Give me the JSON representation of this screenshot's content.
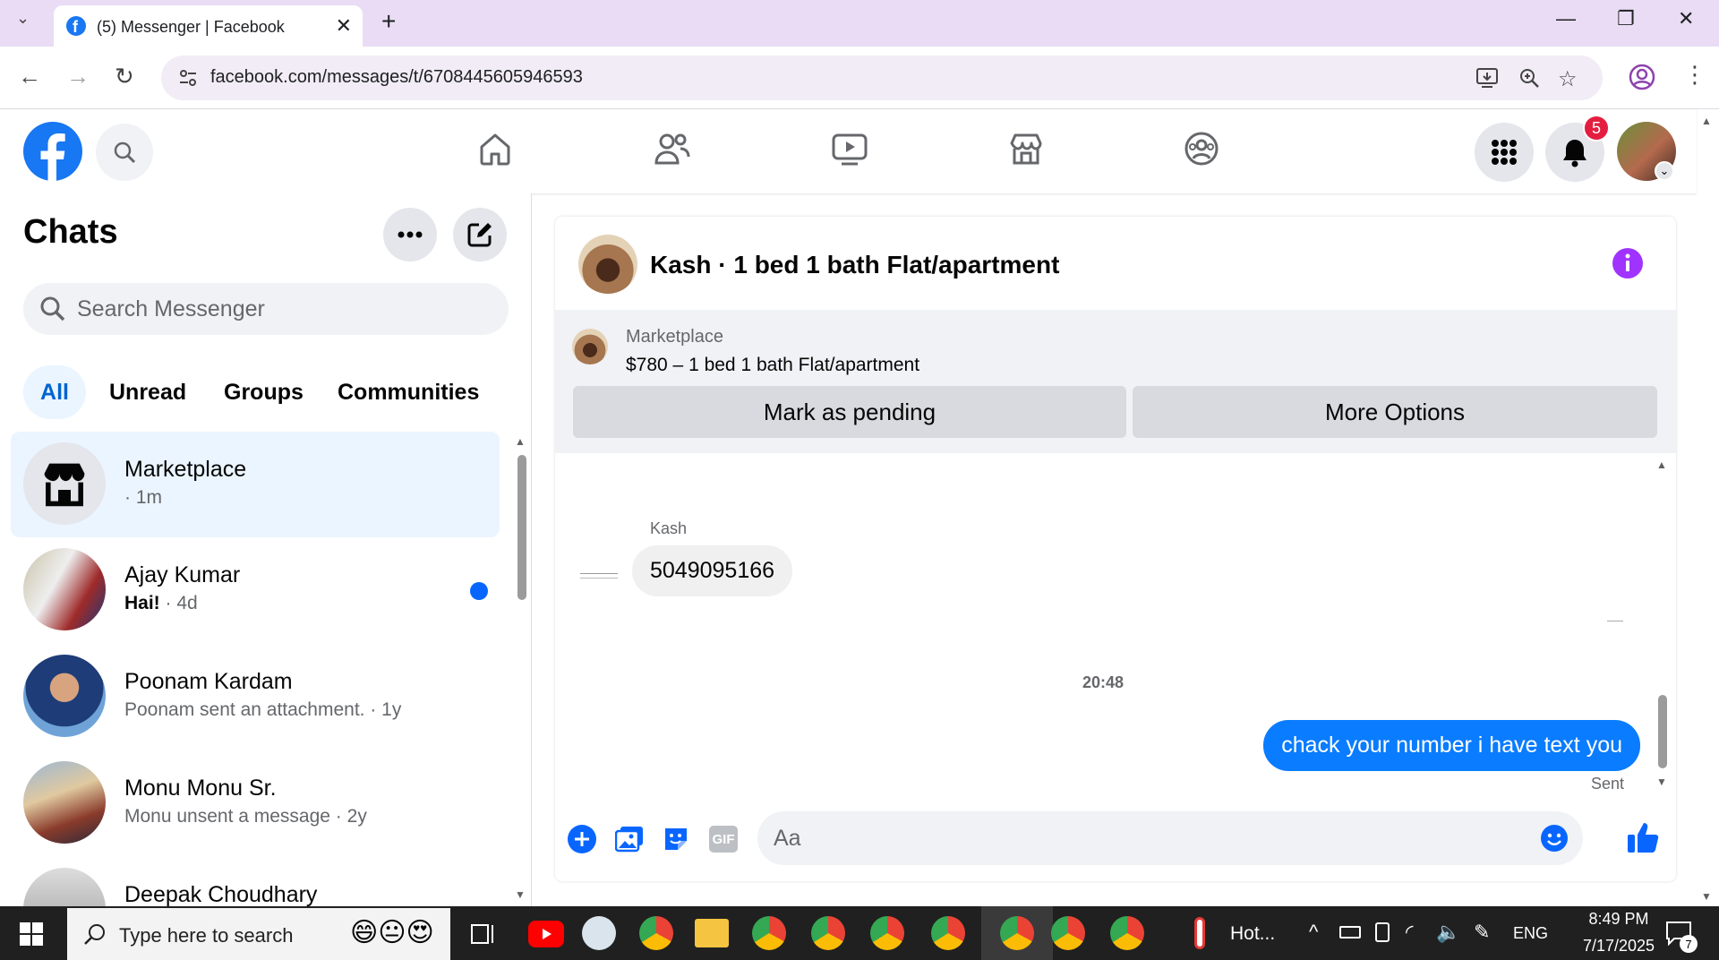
{
  "browser": {
    "tab_title": "(5) Messenger | Facebook",
    "url": "facebook.com/messages/t/6708445605946593",
    "new_tab_label": "+"
  },
  "fb_nav": {
    "notifications_count": "5",
    "brand_color": "#1877f2",
    "badge_color": "#e41e3f"
  },
  "sidebar": {
    "title": "Chats",
    "search_placeholder": "Search Messenger",
    "filters": [
      "All",
      "Unread",
      "Groups",
      "Communities"
    ],
    "chats": [
      {
        "name": "Marketplace",
        "sub": "· 1m",
        "active": true
      },
      {
        "name": "Ajay Kumar",
        "sub_bold": "Hai!",
        "sub": " · 4d",
        "unread": true
      },
      {
        "name": "Poonam Kardam",
        "sub": "Poonam sent an attachment. · 1y"
      },
      {
        "name": "Monu Monu Sr.",
        "sub": "Monu unsent a message · 2y"
      },
      {
        "name": "Deepak Choudhary",
        "sub": ""
      }
    ]
  },
  "conversation": {
    "title": "Kash · 1 bed 1 bath Flat/apartment",
    "marketplace_label": "Marketplace",
    "listing": "$780 – 1 bed 1 bath Flat/apartment",
    "mark_pending": "Mark as pending",
    "more_options": "More Options",
    "messages": [
      {
        "sender": "Kash",
        "text": "5049095166",
        "direction": "in"
      },
      {
        "timestamp": "20:48"
      },
      {
        "text": "chack your number i have text you",
        "direction": "out",
        "status": "Sent"
      }
    ],
    "composer_placeholder": "Aa",
    "accent_color": "#0a7cff"
  },
  "taskbar": {
    "search_placeholder": "Type here to search",
    "weather_label": "Hot...",
    "language": "ENG",
    "time": "8:49 PM",
    "date": "7/17/2025",
    "notification_count": "7"
  }
}
